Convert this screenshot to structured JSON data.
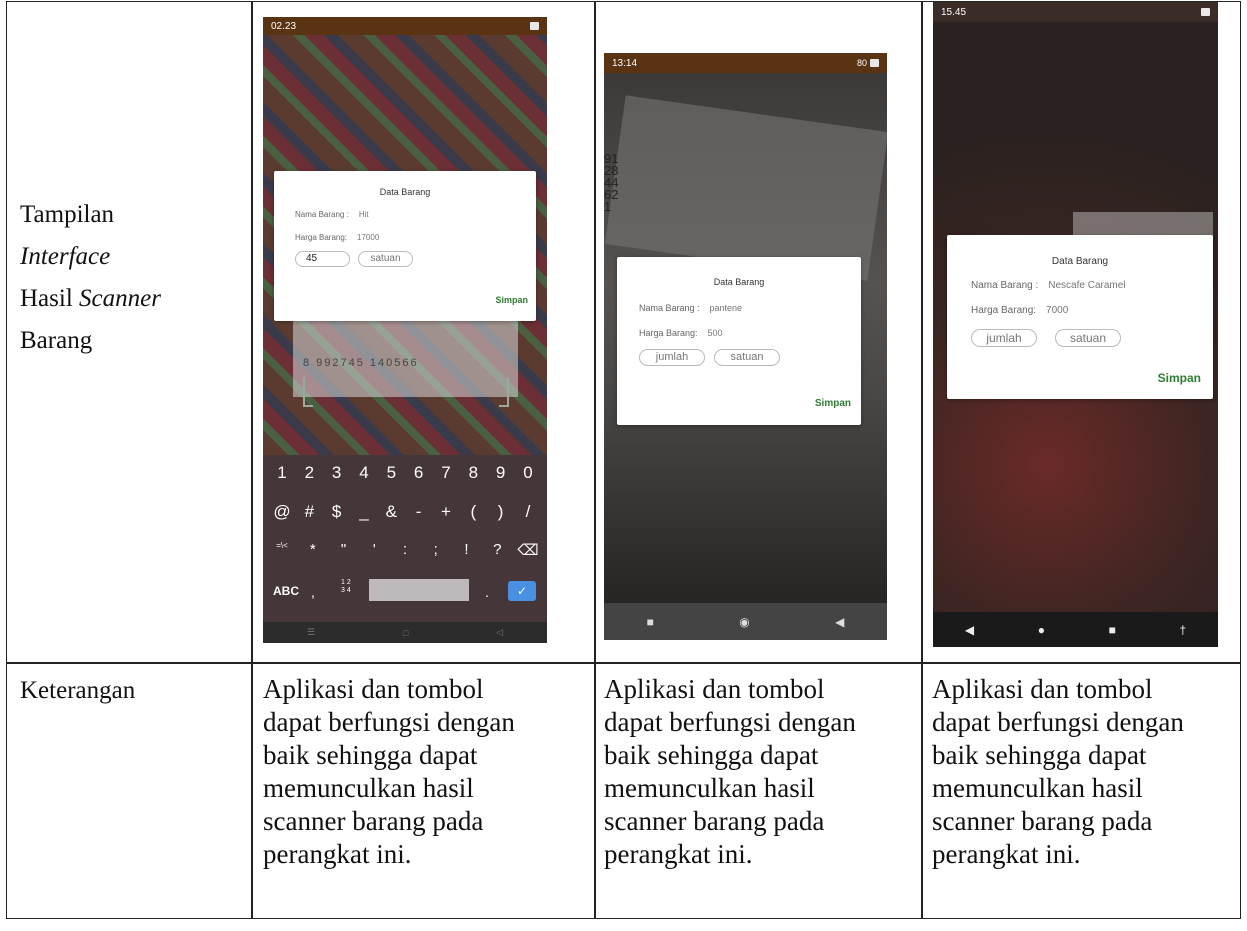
{
  "row1_label": {
    "line1": "Tampilan",
    "line2_italic": "Interface",
    "line3_plain": "Hasil ",
    "line3_italic": "Scanner",
    "line4": "Barang"
  },
  "row2_label": "Keterangan",
  "descriptions": [
    [
      "Aplikasi dan tombol",
      "dapat berfungsi dengan",
      "baik sehingga dapat",
      "memunculkan hasil",
      "scanner barang pada",
      "perangkat ini."
    ],
    [
      "Aplikasi dan tombol",
      "dapat berfungsi dengan",
      "baik sehingga dapat",
      "memunculkan hasil",
      "scanner barang pada",
      "perangkat ini."
    ],
    [
      "Aplikasi dan tombol",
      "dapat berfungsi dengan",
      "baik sehingga dapat",
      "memunculkan hasil",
      "scanner barang pada",
      "perangkat ini."
    ]
  ],
  "phones": [
    {
      "time": "02.23",
      "dialog_title": "Data Barang",
      "name_label": "Nama Barang :",
      "name_value": "Hit",
      "price_label": "Harga Barang:",
      "price_value": "17000",
      "qty_value": "45",
      "unit_placeholder": "satuan",
      "save_label": "Simpan",
      "barcode_digits": "8 992745 140566",
      "keyboard": {
        "row1": [
          "1",
          "2",
          "3",
          "4",
          "5",
          "6",
          "7",
          "8",
          "9",
          "0"
        ],
        "row2": [
          "@",
          "#",
          "$",
          "_",
          "&",
          "-",
          "+",
          "(",
          ")",
          "/"
        ],
        "row3": [
          "=\\<",
          "*",
          "\"",
          "'",
          ":",
          ";",
          "!",
          "?",
          "⌫"
        ],
        "abc": "ABC",
        "comma": ",",
        "num_switch": "1 2\n3 4",
        "period": ".",
        "enter": "✓"
      }
    },
    {
      "time": "13:14",
      "dialog_title": "Data Barang",
      "name_label": "Nama Barang :",
      "name_value": "pantene",
      "price_label": "Harga Barang:",
      "price_value": "500",
      "qty_placeholder": "jumlah",
      "unit_placeholder": "satuan",
      "save_label": "Simpan",
      "side_digits": "912844621",
      "battery": "80"
    },
    {
      "time": "15.45",
      "dialog_title": "Data Barang",
      "name_label": "Nama Barang :",
      "name_value": "Nescafe Caramel",
      "price_label": "Harga Barang:",
      "price_value": "7000",
      "qty_placeholder": "jumlah",
      "unit_placeholder": "satuan",
      "save_label": "Simpan"
    }
  ]
}
